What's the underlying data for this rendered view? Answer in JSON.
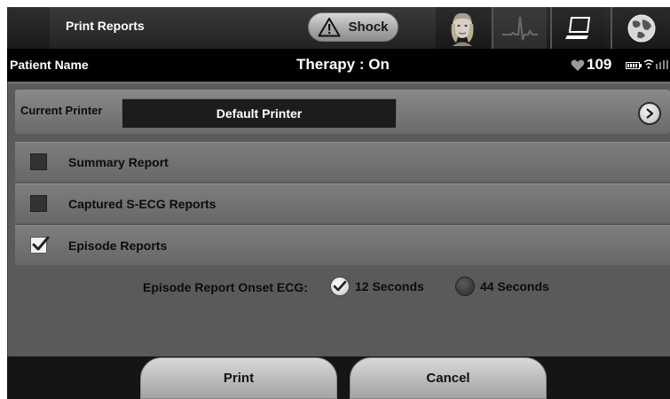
{
  "header": {
    "title": "Print Reports",
    "shock_label": "Shock",
    "tabs": [
      {
        "icon": "patient-icon"
      },
      {
        "icon": "ecg-icon"
      },
      {
        "icon": "computer-icon"
      },
      {
        "icon": "globe-icon"
      }
    ]
  },
  "status": {
    "patient_name": "Patient Name",
    "therapy": "Therapy : On",
    "heart_rate": "109"
  },
  "printer": {
    "label": "Current Printer",
    "value": "Default Printer"
  },
  "reports": [
    {
      "label": "Summary Report",
      "checked": false
    },
    {
      "label": "Captured S-ECG Reports",
      "checked": false
    },
    {
      "label": "Episode Reports",
      "checked": true
    }
  ],
  "onset": {
    "label": "Episode Report Onset ECG:",
    "options": [
      {
        "label": "12 Seconds",
        "selected": true
      },
      {
        "label": "44 Seconds",
        "selected": false
      }
    ]
  },
  "footer": {
    "print_label": "Print",
    "cancel_label": "Cancel"
  },
  "colors": {
    "background": "#3d3d3d",
    "status_bar": "#000000",
    "row": "#767676",
    "button": "#c4c4c4"
  }
}
